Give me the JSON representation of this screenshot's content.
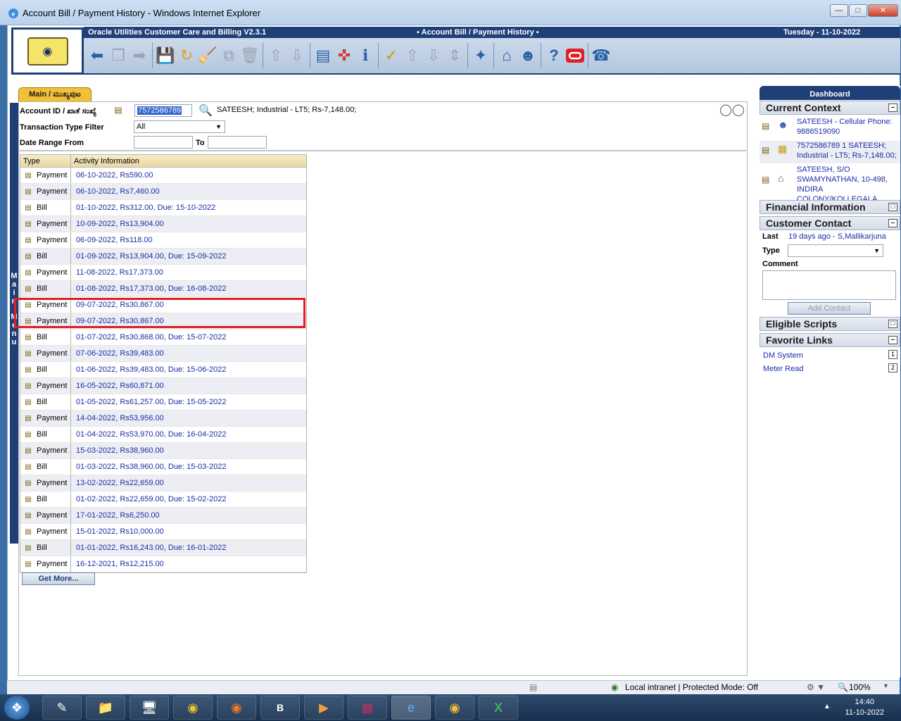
{
  "window": {
    "title": "Account Bill / Payment History - Windows Internet Explorer"
  },
  "header": {
    "app_name": "Oracle Utilities Customer Care and Billing V2.3.1",
    "page_title": "▪ Account Bill / Payment History ▪",
    "date": "Tuesday - 11-10-2022"
  },
  "tab": {
    "label": "Main / ಮುಖ್ಯಪುಟ"
  },
  "form": {
    "account_label": "Account ID / ಖಾತೆ ಸಂಖ್ಯೆ",
    "account_id": "7572586789",
    "account_info": "SATEESH; Industrial - LT5; Rs-7,148.00;",
    "filter_label": "Transaction Type Filter",
    "filter_value": "All",
    "date_from_label": "Date Range From",
    "date_to_label": "To"
  },
  "side_menu": {
    "letters": [
      "M",
      "a",
      "i",
      "n",
      "",
      "M",
      "e",
      "n",
      "u"
    ]
  },
  "grid": {
    "headers": {
      "type": "Type",
      "info": "Activity Information"
    },
    "rows": [
      {
        "type": "Payment",
        "info": "06-10-2022, Rs590.00"
      },
      {
        "type": "Payment",
        "info": "06-10-2022, Rs7,460.00"
      },
      {
        "type": "Bill",
        "info": "01-10-2022, Rs312.00, Due: 15-10-2022"
      },
      {
        "type": "Payment",
        "info": "10-09-2022, Rs13,904.00"
      },
      {
        "type": "Payment",
        "info": "06-09-2022, Rs118.00"
      },
      {
        "type": "Bill",
        "info": "01-09-2022, Rs13,904.00, Due: 15-09-2022"
      },
      {
        "type": "Payment",
        "info": "11-08-2022, Rs17,373.00"
      },
      {
        "type": "Bill",
        "info": "01-08-2022, Rs17,373.00, Due: 16-08-2022"
      },
      {
        "type": "Payment",
        "info": "09-07-2022, Rs30,867.00"
      },
      {
        "type": "Payment",
        "info": "09-07-2022, Rs30,867.00"
      },
      {
        "type": "Bill",
        "info": "01-07-2022, Rs30,868.00, Due: 15-07-2022"
      },
      {
        "type": "Payment",
        "info": "07-06-2022, Rs39,483.00"
      },
      {
        "type": "Bill",
        "info": "01-06-2022, Rs39,483.00, Due: 15-06-2022"
      },
      {
        "type": "Payment",
        "info": "16-05-2022, Rs60,871.00"
      },
      {
        "type": "Bill",
        "info": "01-05-2022, Rs61,257.00, Due: 15-05-2022"
      },
      {
        "type": "Payment",
        "info": "14-04-2022, Rs53,956.00"
      },
      {
        "type": "Bill",
        "info": "01-04-2022, Rs53,970.00, Due: 16-04-2022"
      },
      {
        "type": "Payment",
        "info": "15-03-2022, Rs38,960.00"
      },
      {
        "type": "Bill",
        "info": "01-03-2022, Rs38,960.00, Due: 15-03-2022"
      },
      {
        "type": "Payment",
        "info": "13-02-2022, Rs22,659.00"
      },
      {
        "type": "Bill",
        "info": "01-02-2022, Rs22,659.00, Due: 15-02-2022"
      },
      {
        "type": "Payment",
        "info": "17-01-2022, Rs6,250.00"
      },
      {
        "type": "Payment",
        "info": "15-01-2022, Rs10,000.00"
      },
      {
        "type": "Bill",
        "info": "01-01-2022, Rs16,243.00, Due: 16-01-2022"
      },
      {
        "type": "Payment",
        "info": "16-12-2021, Rs12,215.00"
      }
    ],
    "get_more_label": "Get More..."
  },
  "dashboard": {
    "title": "Dashboard",
    "current_context": {
      "title": "Current Context",
      "items": [
        {
          "line1": "SATEESH - Cellular Phone:",
          "line2": "9886519090",
          "line3": ""
        },
        {
          "line1": "7572586789 1 SATEESH;",
          "line2": "Industrial - LT5; Rs-7,148.00;",
          "line3": ""
        },
        {
          "line1": "SATEESH, S/O",
          "line2": "SWAMYNATHAN, 10-498,",
          "line3": "INDIRA COLONY/KOLLEGALA"
        }
      ]
    },
    "financial_information": {
      "title": "Financial Information"
    },
    "customer_contact": {
      "title": "Customer Contact",
      "last_label": "Last",
      "last_value": "19 days ago - S,Mallikarjuna",
      "type_label": "Type",
      "comment_label": "Comment",
      "add_button": "Add Contact"
    },
    "eligible_scripts": {
      "title": "Eligible Scripts"
    },
    "favorite_links": {
      "title": "Favorite Links",
      "items": [
        {
          "label": "DM System",
          "num": "1"
        },
        {
          "label": "Meter Read",
          "num": "2"
        }
      ]
    }
  },
  "statusbar": {
    "zone": "Local intranet | Protected Mode: Off",
    "zoom": "100%"
  },
  "taskbar": {
    "time": "14:40",
    "date": "11-10-2022",
    "app_b_label": "B"
  }
}
